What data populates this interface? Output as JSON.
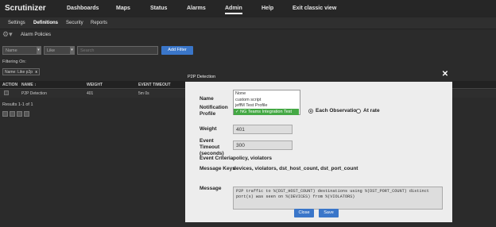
{
  "topnav": {
    "brand": "Scrutinizer",
    "items": [
      "Dashboards",
      "Maps",
      "Status",
      "Alarms",
      "Admin",
      "Help",
      "Exit classic view"
    ]
  },
  "subnav": {
    "items": [
      "Settings",
      "Definitions",
      "Security",
      "Reports"
    ]
  },
  "breadcrumb": {
    "title": "Alarm Policies"
  },
  "filter_bar": {
    "field_select": "Name",
    "operator_select": "Like",
    "search_placeholder": "Search",
    "add_filter_label": "Add Filter"
  },
  "filtering": {
    "label": "Filtering On:",
    "chip": "Name: Like p2p",
    "chip_close": "x"
  },
  "table": {
    "headers": [
      "ACTION",
      "NAME",
      "WEIGHT",
      "EVENT TIMEOUT"
    ],
    "sort_icon": "↕",
    "rows": [
      {
        "name": "P2P Detection",
        "weight": "401",
        "timeout": "5m 0s"
      }
    ]
  },
  "results": {
    "text": "Results 1-1 of 1"
  },
  "modal": {
    "title": "P2P Detection",
    "name_label": "Name",
    "profile_label": "Notification Profile",
    "profile_options": [
      "None",
      "custom script",
      "jeffM Test Profile",
      "✓ NG Teams Integration Test"
    ],
    "each_observation_label": "Each Observation",
    "at_rate_label": "At rate",
    "weight_label": "Weight",
    "weight_value": "401",
    "timeout_label": "Event Timeout (seconds)",
    "timeout_value": "300",
    "criteria_label": "Event Criteria",
    "criteria_value": "policy, violators",
    "keys_label": "Message Keys",
    "keys_value": "devices, violators, dst_host_count, dst_port_count",
    "message_label": "Message",
    "message_value": "P2P traffic to %(DST_HOST_COUNT) destinations using %(DST_PORT_COUNT) distinct port(s) was seen on %(DEVICES) from %(VIOLATORS)",
    "close_label": "Close",
    "save_label": "Save"
  }
}
